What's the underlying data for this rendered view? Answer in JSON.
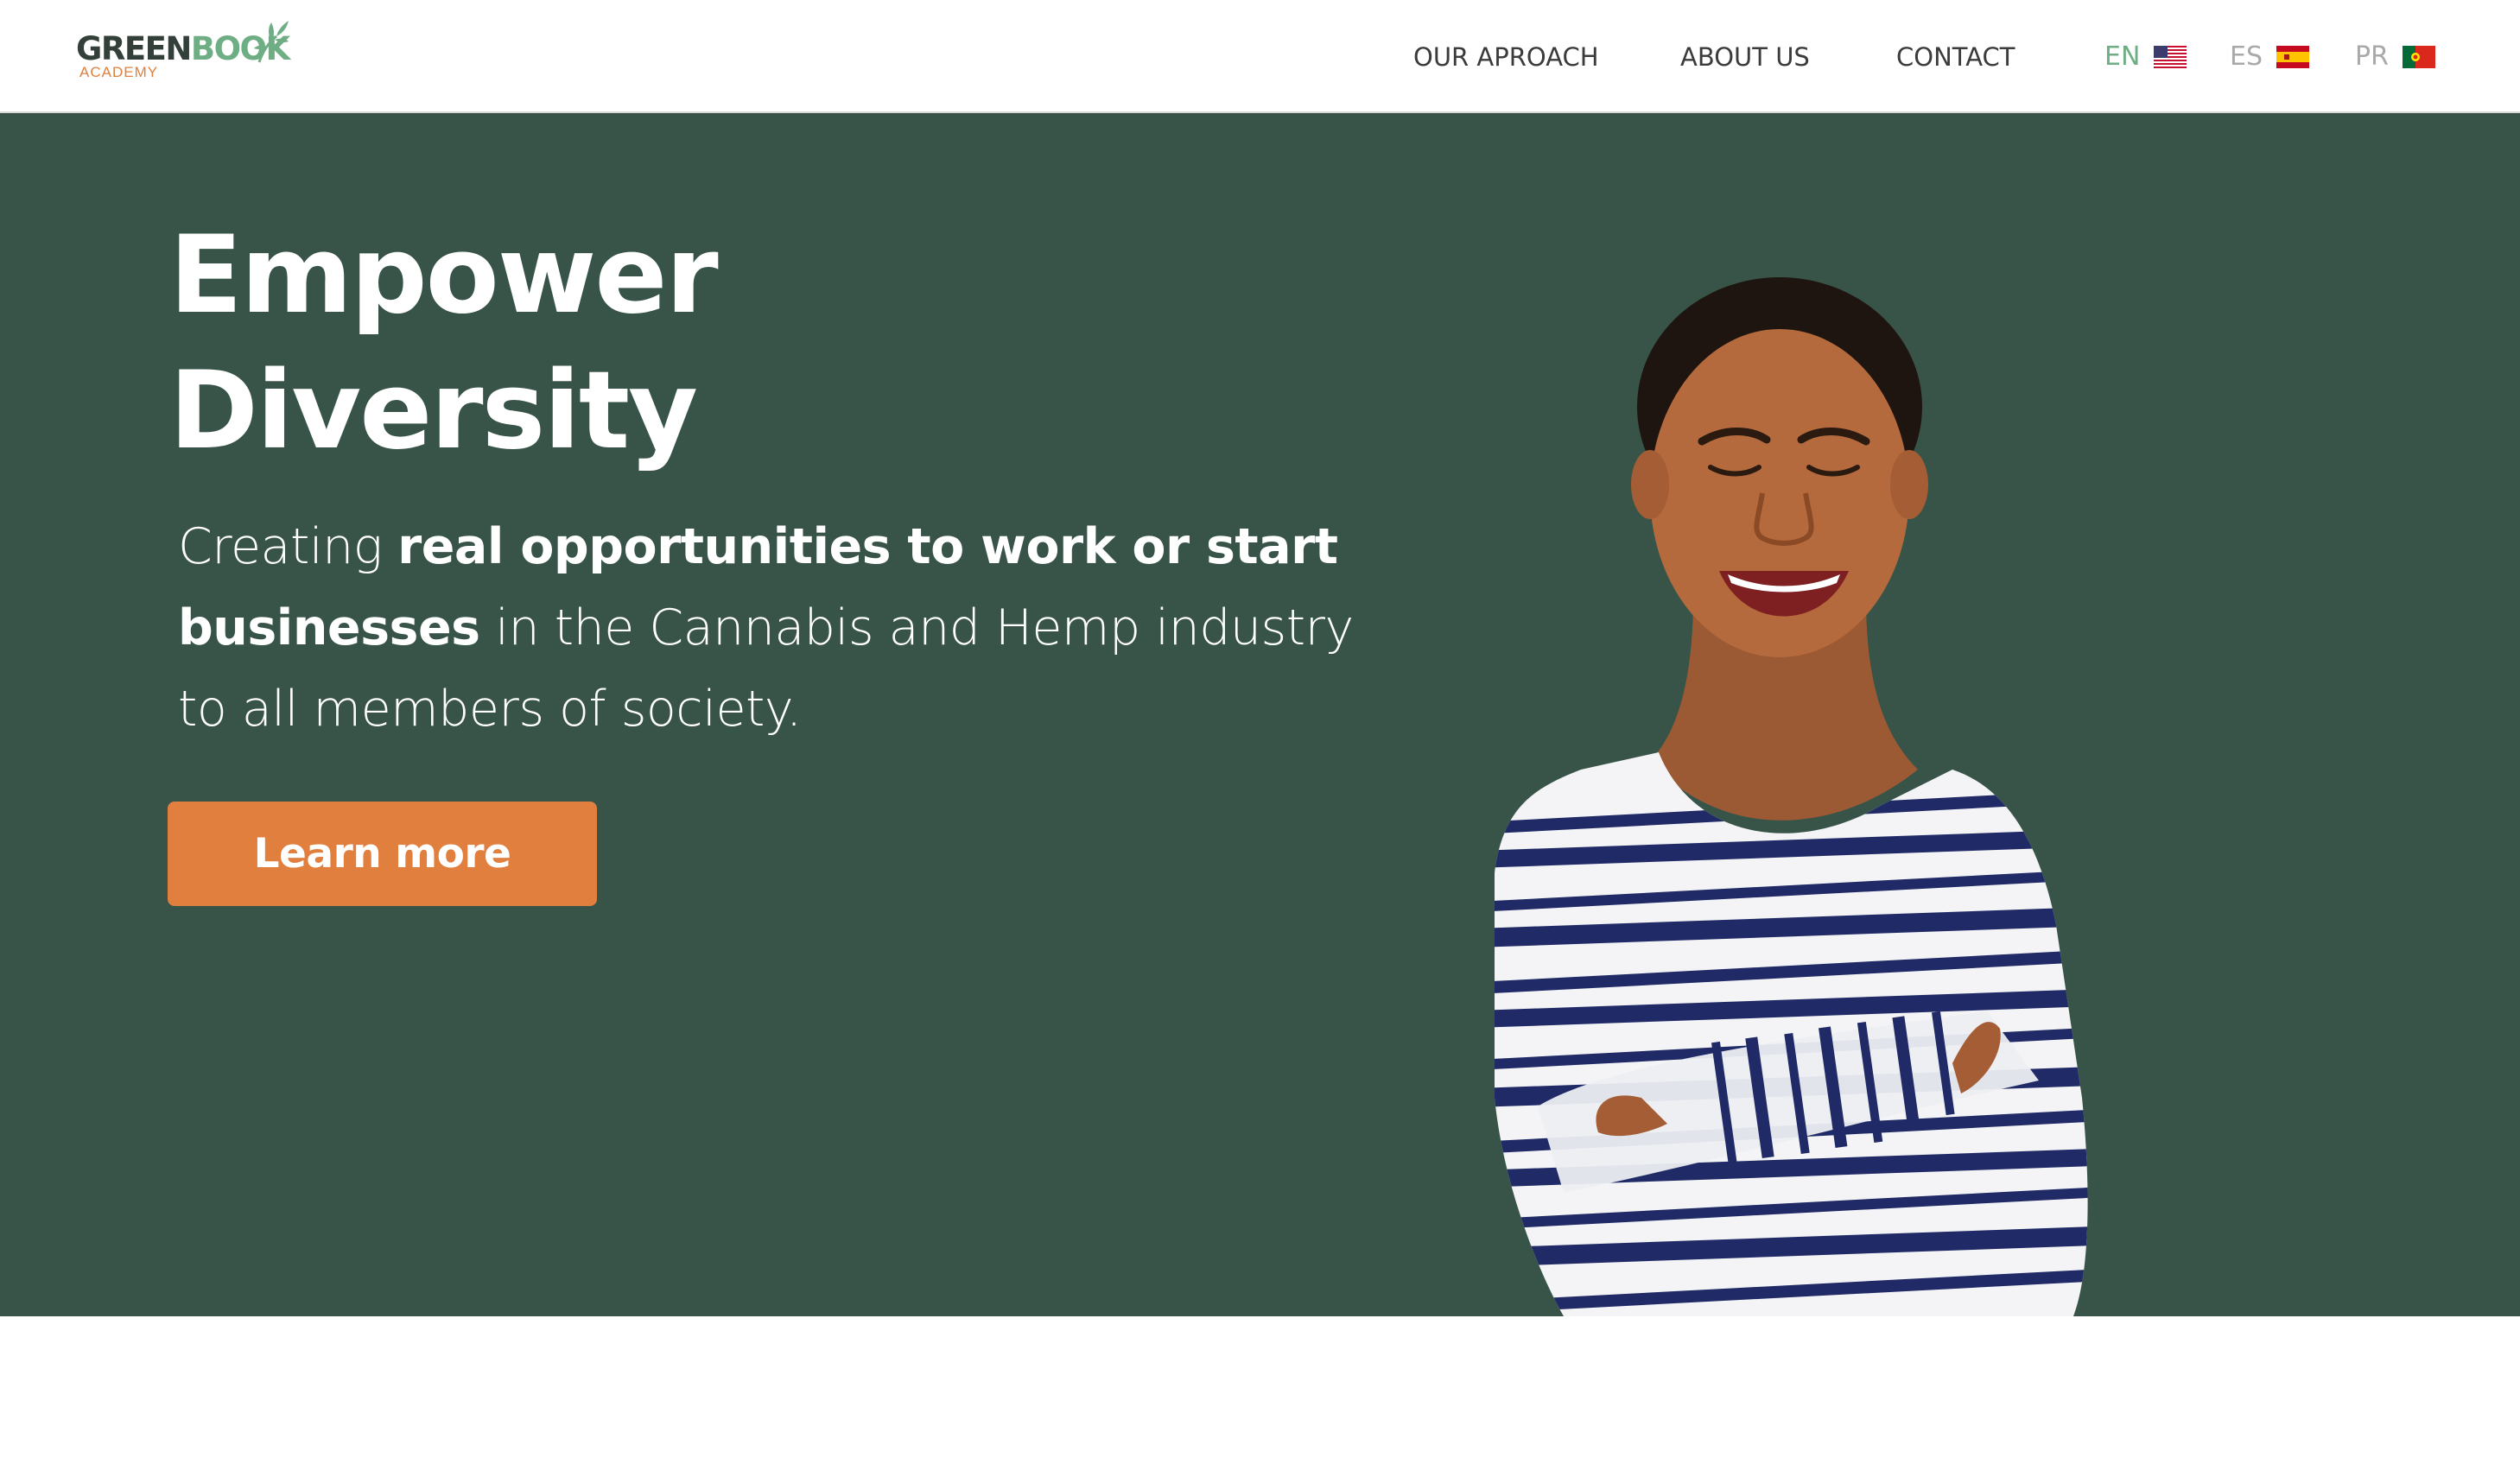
{
  "brand": {
    "wordmark_dark": "GREEN",
    "wordmark_green": "BOOK",
    "subtitle": "ACADEMY",
    "icon": "cannabis-leaf-icon",
    "colors": {
      "dark": "#33403a",
      "green": "#6fae85",
      "orange": "#e07f3e"
    }
  },
  "nav": {
    "items": [
      {
        "label": "OUR APROACH"
      },
      {
        "label": "ABOUT US"
      },
      {
        "label": "CONTACT"
      }
    ]
  },
  "languages": [
    {
      "code": "EN",
      "flag": "us-flag-icon",
      "active": true
    },
    {
      "code": "ES",
      "flag": "spain-flag-icon",
      "active": false
    },
    {
      "code": "PR",
      "flag": "portugal-flag-icon",
      "active": false
    }
  ],
  "hero": {
    "title_line1": "Empower",
    "title_line2": "Diversity",
    "subtitle": {
      "part1": "Creating ",
      "bold1": "real opportunities to work or start businesses",
      "part2": " in the Cannabis and Hemp industry to all members of society."
    },
    "cta_label": "Learn more",
    "background_color": "#385448"
  }
}
